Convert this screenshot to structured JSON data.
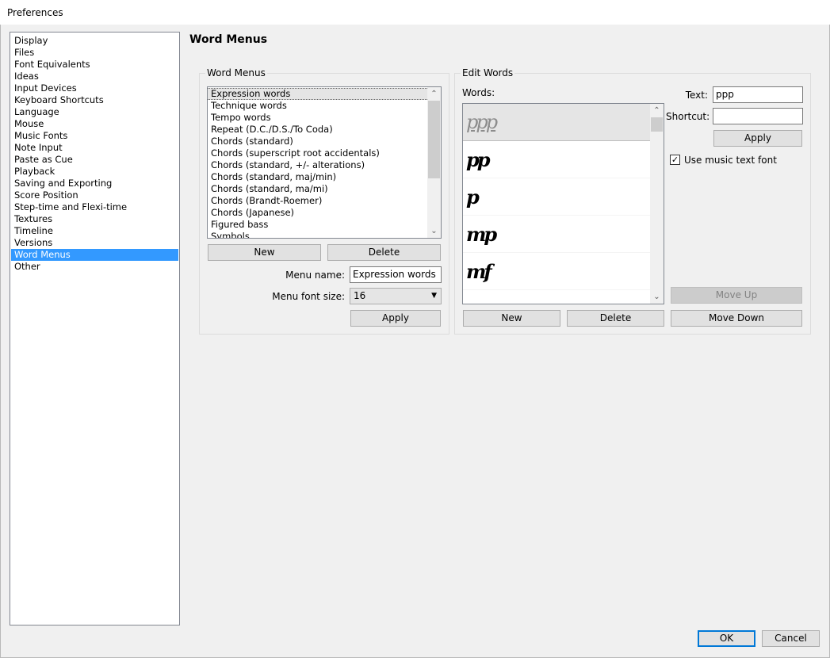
{
  "window": {
    "title": "Preferences"
  },
  "categories": [
    {
      "label": "Display"
    },
    {
      "label": "Files"
    },
    {
      "label": "Font Equivalents"
    },
    {
      "label": "Ideas"
    },
    {
      "label": "Input Devices"
    },
    {
      "label": "Keyboard Shortcuts"
    },
    {
      "label": "Language"
    },
    {
      "label": "Mouse"
    },
    {
      "label": "Music Fonts"
    },
    {
      "label": "Note Input"
    },
    {
      "label": "Paste as Cue"
    },
    {
      "label": "Playback"
    },
    {
      "label": "Saving and Exporting"
    },
    {
      "label": "Score Position"
    },
    {
      "label": "Step-time and Flexi-time"
    },
    {
      "label": "Textures"
    },
    {
      "label": "Timeline"
    },
    {
      "label": "Versions"
    },
    {
      "label": "Word Menus",
      "selected": true
    },
    {
      "label": "Other"
    }
  ],
  "page_title": "Word Menus",
  "word_menus": {
    "group_label": "Word Menus",
    "items": [
      {
        "label": "Expression words",
        "selected": true
      },
      {
        "label": "Technique words"
      },
      {
        "label": "Tempo words"
      },
      {
        "label": "Repeat (D.C./D.S./To Coda)"
      },
      {
        "label": "Chords (standard)"
      },
      {
        "label": "Chords (superscript root accidentals)"
      },
      {
        "label": "Chords (standard, +/- alterations)"
      },
      {
        "label": "Chords (standard, maj/min)"
      },
      {
        "label": "Chords (standard, ma/mi)"
      },
      {
        "label": "Chords (Brandt-Roemer)"
      },
      {
        "label": "Chords (Japanese)"
      },
      {
        "label": "Figured bass"
      },
      {
        "label": "Symbols"
      }
    ],
    "new_label": "New",
    "delete_label": "Delete",
    "menu_name_label": "Menu name:",
    "menu_name_value": "Expression words",
    "menu_font_size_label": "Menu font size:",
    "menu_font_size_value": "16",
    "apply_label": "Apply"
  },
  "edit_words": {
    "group_label": "Edit Words",
    "words_label": "Words:",
    "words": [
      {
        "text": "ppp",
        "selected": true
      },
      {
        "text": "pp"
      },
      {
        "text": "p"
      },
      {
        "text": "mp"
      },
      {
        "text": "mf"
      }
    ],
    "text_label": "Text:",
    "text_value": "ppp",
    "shortcut_label": "Shortcut:",
    "shortcut_value": "",
    "apply_label": "Apply",
    "use_music_font_label": "Use music text font",
    "use_music_font_checked": true,
    "move_up_label": "Move Up",
    "move_down_label": "Move Down",
    "new_label": "New",
    "delete_label": "Delete"
  },
  "footer": {
    "ok_label": "OK",
    "cancel_label": "Cancel"
  },
  "icons": {
    "scroll_up": "chevron-up-icon",
    "scroll_down": "chevron-down-icon",
    "combo": "dropdown-arrow-icon",
    "check": "checkmark-icon"
  }
}
